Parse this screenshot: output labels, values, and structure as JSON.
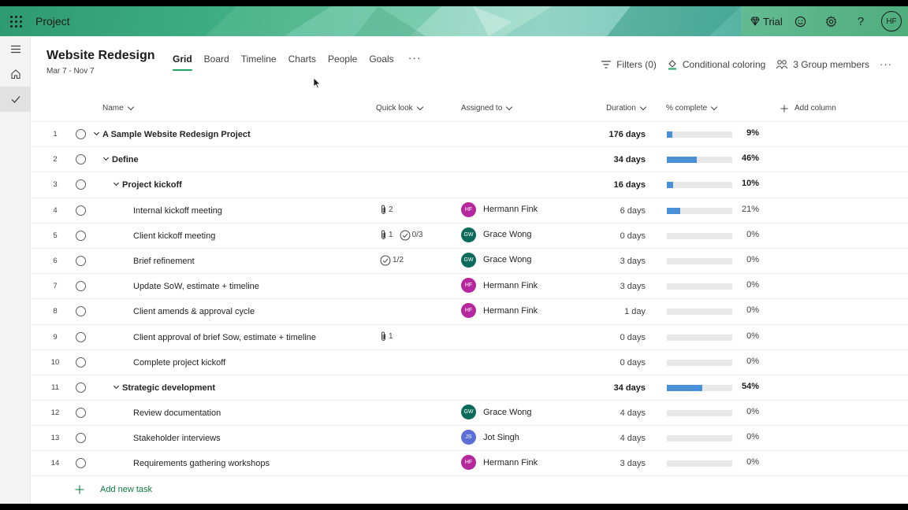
{
  "app": {
    "title": "Project"
  },
  "topbar": {
    "trial_label": "Trial",
    "avatar_initials": "HF",
    "icons": [
      "waffle-icon",
      "diamond-icon",
      "smiley-icon",
      "gear-icon",
      "help-icon"
    ]
  },
  "rail": {
    "icons": [
      "hamburger-icon",
      "home-icon",
      "checkmark-icon"
    ]
  },
  "project": {
    "title": "Website Redesign",
    "dates": "Mar 7 - Nov 7"
  },
  "tabs": [
    {
      "label": "Grid",
      "active": true
    },
    {
      "label": "Board"
    },
    {
      "label": "Timeline"
    },
    {
      "label": "Charts"
    },
    {
      "label": "People"
    },
    {
      "label": "Goals"
    }
  ],
  "tab_more": "···",
  "actions": {
    "filters": "Filters (0)",
    "conditional": "Conditional coloring",
    "members": "3 Group members",
    "more": "···"
  },
  "columns": {
    "name": "Name",
    "quick_look": "Quick look",
    "assigned": "Assigned to",
    "duration": "Duration",
    "percent": "% complete",
    "add_column": "Add column"
  },
  "colors": {
    "accent": "#21a366",
    "progress": "#4a90d9",
    "hf": "#b4279d",
    "gw": "#0b6a5a",
    "js": "#5b6fd6"
  },
  "tasks": [
    {
      "num": "1",
      "name": "A Sample Website Redesign Project",
      "level": 0,
      "summary": true,
      "duration": "176 days",
      "pct": "9%",
      "progress": 0.09
    },
    {
      "num": "2",
      "name": "Define",
      "level": 1,
      "summary": true,
      "duration": "34 days",
      "pct": "46%",
      "progress": 0.46
    },
    {
      "num": "3",
      "name": "Project kickoff",
      "level": 2,
      "summary": true,
      "duration": "16 days",
      "pct": "10%",
      "progress": 0.1
    },
    {
      "num": "4",
      "name": "Internal kickoff meeting",
      "level": 3,
      "attach": "2",
      "assignee": "Hermann Fink",
      "initials": "HF",
      "avcolor": "hf",
      "duration": "6 days",
      "pct": "21%",
      "progress": 0.21
    },
    {
      "num": "5",
      "name": "Client kickoff meeting",
      "level": 3,
      "attach": "1",
      "checklist": "0/3",
      "assignee": "Grace Wong",
      "initials": "GW",
      "avcolor": "gw",
      "duration": "0 days",
      "pct": "0%",
      "progress": 0
    },
    {
      "num": "6",
      "name": "Brief refinement",
      "level": 3,
      "checklist": "1/2",
      "assignee": "Grace Wong",
      "initials": "GW",
      "avcolor": "gw",
      "duration": "3 days",
      "pct": "0%",
      "progress": 0
    },
    {
      "num": "7",
      "name": "Update SoW, estimate + timeline",
      "level": 3,
      "assignee": "Hermann Fink",
      "initials": "HF",
      "avcolor": "hf",
      "duration": "3 days",
      "pct": "0%",
      "progress": 0
    },
    {
      "num": "8",
      "name": "Client amends & approval cycle",
      "level": 3,
      "assignee": "Hermann Fink",
      "initials": "HF",
      "avcolor": "hf",
      "duration": "1 day",
      "pct": "0%",
      "progress": 0
    },
    {
      "num": "9",
      "name": "Client approval of brief Sow, estimate + timeline",
      "level": 3,
      "attach": "1",
      "duration": "0 days",
      "pct": "0%",
      "progress": 0
    },
    {
      "num": "10",
      "name": "Complete project kickoff",
      "level": 3,
      "duration": "0 days",
      "pct": "0%",
      "progress": 0
    },
    {
      "num": "11",
      "name": "Strategic development",
      "level": 2,
      "summary": true,
      "duration": "34 days",
      "pct": "54%",
      "progress": 0.54
    },
    {
      "num": "12",
      "name": "Review documentation",
      "level": 3,
      "assignee": "Grace Wong",
      "initials": "GW",
      "avcolor": "gw",
      "duration": "4 days",
      "pct": "0%",
      "progress": 0
    },
    {
      "num": "13",
      "name": "Stakeholder interviews",
      "level": 3,
      "assignee": "Jot Singh",
      "initials": "JS",
      "avcolor": "js",
      "duration": "4 days",
      "pct": "0%",
      "progress": 0
    },
    {
      "num": "14",
      "name": "Requirements gathering workshops",
      "level": 3,
      "assignee": "Hermann Fink",
      "initials": "HF",
      "avcolor": "hf",
      "duration": "3 days",
      "pct": "0%",
      "progress": 0
    }
  ],
  "add_task": "Add new task"
}
